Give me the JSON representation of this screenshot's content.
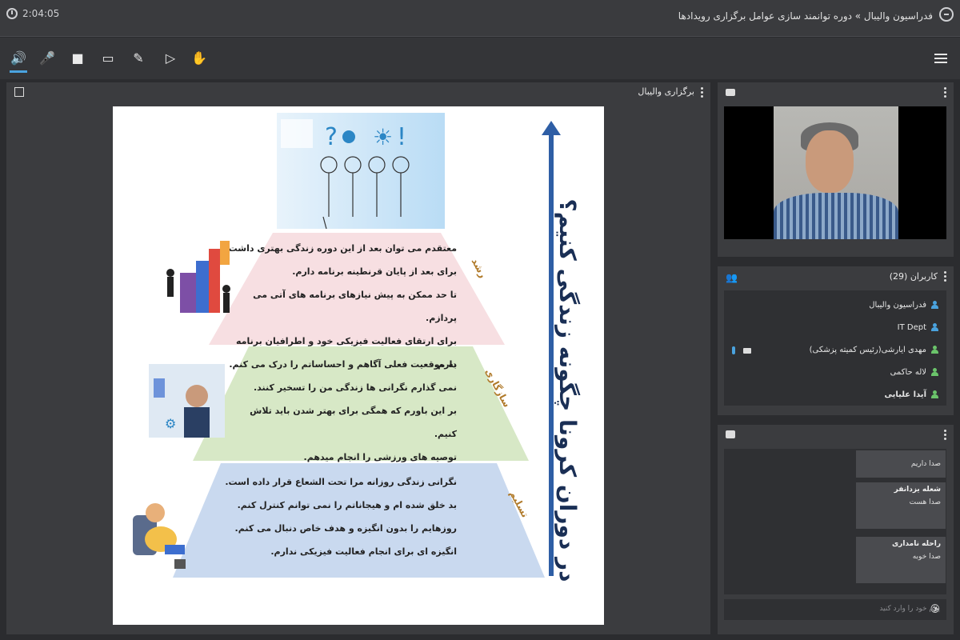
{
  "titlebar": {
    "time": "2:04:05",
    "breadcrumb": "فدراسیون والیبال » دوره توانمند سازی عوامل برگزاری رویدادها"
  },
  "toolbar": {
    "tools": [
      "speaker-icon",
      "mic-muted-icon",
      "camera-icon",
      "screen-share-icon",
      "brush-icon",
      "present-icon",
      "raise-hand-icon"
    ],
    "menu": "hamburger-icon"
  },
  "presentation": {
    "title": "برگزاری والیبال",
    "slide": {
      "vertical_title": "در دوران کرونا چگونه زندگی کنیم؟",
      "bands": [
        {
          "label": "رشد",
          "color": "#f7dfe2",
          "lines": [
            "معتقدم می توان بعد از این دوره زندگی بهتری داشت.",
            "برای بعد از پایان قرنطینه برنامه دارم.",
            "تا حد ممکن به پیش نیازهای برنامه های آتی می پردازم.",
            "برای ارتقای فعالیت فیزیکی خود و اطرافیان برنامه دارم."
          ]
        },
        {
          "label": "سازگاری",
          "color": "#d7e8c6",
          "lines": [
            "به موقعیت فعلی آگاهم و احساساتم را درک می کنم.",
            "نمی گذارم نگرانی ها زندگی من را تسخیر کنند.",
            "بر این باورم که همگی برای بهتر شدن باید تلاش کنیم.",
            "توصیه های ورزشی را انجام میدهم."
          ]
        },
        {
          "label": "تسلیم",
          "color": "#c9d9ef",
          "lines": [
            "نگرانی زندگی روزانه مرا تحت الشعاع قرار داده است.",
            "بد خلق شده ام و هیجاناتم را نمی توانم کنترل کنم.",
            "روزهایم را بدون انگیزه و هدف خاص دنبال می کنم.",
            "انگیزه ای برای انجام فعالیت فیزیکی ندارم."
          ]
        }
      ]
    }
  },
  "webcam": {
    "icon": "camera-icon"
  },
  "users": {
    "header": "کاربران (29)",
    "list": [
      {
        "name": "فدراسیون والیبال",
        "color": "#4aa3df",
        "bold": false
      },
      {
        "name": "IT Dept",
        "color": "#4aa3df",
        "bold": false
      },
      {
        "name": "مهدی ایارشی(رئیس کمیته پزشکی)",
        "color": "#6bc46b",
        "bold": false
      },
      {
        "name": "لاله حاکمی",
        "color": "#6bc46b",
        "bold": false
      },
      {
        "name": "آیدا علیایی",
        "color": "#6bc46b",
        "bold": true
      }
    ]
  },
  "chat": {
    "messages": [
      {
        "name": "",
        "text": "صدا داریم"
      },
      {
        "name": "شعله یزدانفر",
        "text": "صدا هست"
      },
      {
        "name": "راحله نامداری",
        "text": "صدا خوبه"
      }
    ],
    "placeholder": "پیام خود را وارد کنید"
  }
}
